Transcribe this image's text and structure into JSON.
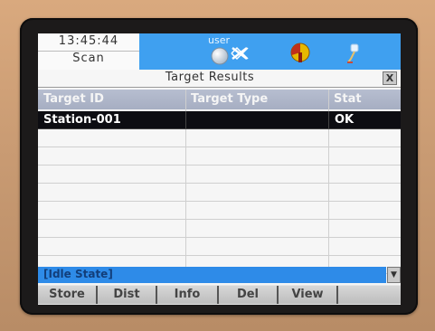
{
  "status_bar": {
    "time": "13:45:44",
    "mode": "Scan",
    "user_label": "user",
    "icons": [
      "user-globe-icon",
      "signal-off-icon",
      "battery-pie-icon",
      "plug-icon"
    ]
  },
  "title_bar": {
    "title": "Target Results",
    "close_label": "X"
  },
  "table": {
    "columns": [
      "Target ID",
      "Target Type",
      "Stat"
    ],
    "rows": [
      {
        "target_id": "Station-001",
        "target_type": "",
        "stat": "OK",
        "selected": true
      },
      {
        "target_id": "",
        "target_type": "",
        "stat": ""
      },
      {
        "target_id": "",
        "target_type": "",
        "stat": ""
      },
      {
        "target_id": "",
        "target_type": "",
        "stat": ""
      },
      {
        "target_id": "",
        "target_type": "",
        "stat": ""
      },
      {
        "target_id": "",
        "target_type": "",
        "stat": ""
      },
      {
        "target_id": "",
        "target_type": "",
        "stat": ""
      },
      {
        "target_id": "",
        "target_type": "",
        "stat": ""
      },
      {
        "target_id": "",
        "target_type": "",
        "stat": ""
      }
    ]
  },
  "state_bar": {
    "text": "[Idle State]"
  },
  "soft_keys": [
    "Store",
    "Dist",
    "Info",
    "Del",
    "View",
    ""
  ],
  "colors": {
    "status_blue": "#3fa0f0",
    "header_gray": "#a6aec2",
    "selected_row": "#0d0d12",
    "state_blue": "#2e8be8"
  }
}
